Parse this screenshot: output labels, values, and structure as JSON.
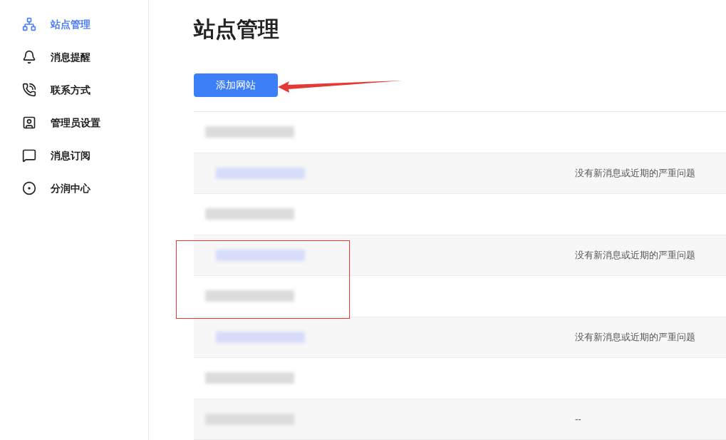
{
  "sidebar": {
    "items": [
      {
        "label": "站点管理",
        "selected": true
      },
      {
        "label": "消息提醒",
        "selected": false
      },
      {
        "label": "联系方式",
        "selected": false
      },
      {
        "label": "管理员设置",
        "selected": false
      },
      {
        "label": "消息订阅",
        "selected": false
      },
      {
        "label": "分润中心",
        "selected": false
      }
    ]
  },
  "page": {
    "title": "站点管理",
    "add_button": "添加网站"
  },
  "table": {
    "rows": [
      {
        "kind": "plain"
      },
      {
        "kind": "link",
        "status": "没有新消息或近期的严重问题"
      },
      {
        "kind": "plain"
      },
      {
        "kind": "link",
        "status": "没有新消息或近期的严重问题"
      },
      {
        "kind": "plain"
      },
      {
        "kind": "link",
        "status": "没有新消息或近期的严重问题"
      },
      {
        "kind": "plain"
      },
      {
        "kind": "plain",
        "status": "--"
      }
    ]
  }
}
